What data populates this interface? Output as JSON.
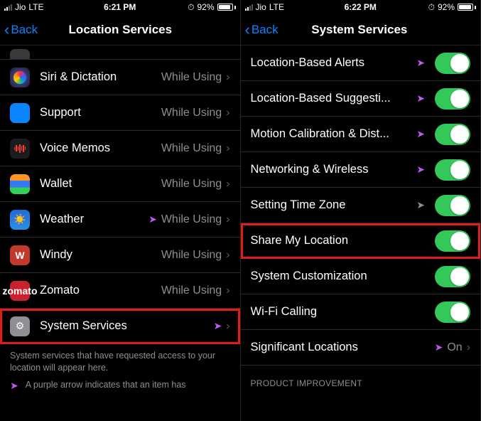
{
  "left": {
    "status": {
      "carrier": "Jio",
      "network": "LTE",
      "time": "6:21 PM",
      "battery": "92%",
      "alarm": "⏱"
    },
    "nav": {
      "back": "Back",
      "title": "Location Services"
    },
    "rows": [
      {
        "label": "Siri & Dictation",
        "detail": "While Using"
      },
      {
        "label": "Support",
        "detail": "While Using"
      },
      {
        "label": "Voice Memos",
        "detail": "While Using"
      },
      {
        "label": "Wallet",
        "detail": "While Using"
      },
      {
        "label": "Weather",
        "detail": "While Using"
      },
      {
        "label": "Windy",
        "detail": "While Using"
      },
      {
        "label": "Zomato",
        "detail": "While Using"
      },
      {
        "label": "System Services",
        "detail": ""
      }
    ],
    "footer": "System services that have requested access to your location will appear here.",
    "legend": "A purple arrow indicates that an item has"
  },
  "right": {
    "status": {
      "carrier": "Jio",
      "network": "LTE",
      "time": "6:22 PM",
      "battery": "92%",
      "alarm": "⏱"
    },
    "nav": {
      "back": "Back",
      "title": "System Services"
    },
    "rows": [
      {
        "label": "Location-Based Alerts"
      },
      {
        "label": "Location-Based Suggesti..."
      },
      {
        "label": "Motion Calibration & Dist..."
      },
      {
        "label": "Networking & Wireless"
      },
      {
        "label": "Setting Time Zone"
      },
      {
        "label": "Share My Location"
      },
      {
        "label": "System Customization"
      },
      {
        "label": "Wi-Fi Calling"
      }
    ],
    "sigloc": {
      "label": "Significant Locations",
      "detail": "On"
    },
    "section": "PRODUCT IMPROVEMENT"
  }
}
